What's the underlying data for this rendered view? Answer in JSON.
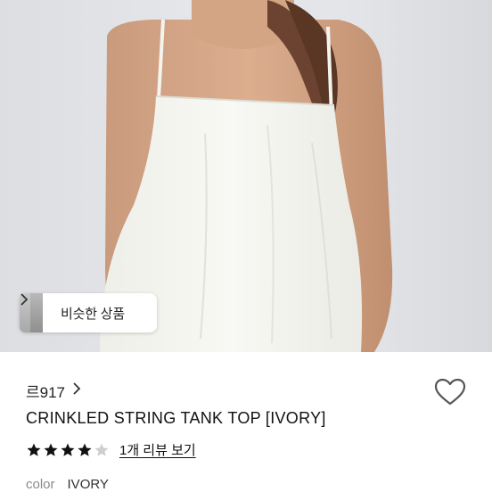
{
  "similar_products": {
    "label": "비슷한 상품",
    "icon": "chevron-right-icon"
  },
  "store": {
    "name": "르917",
    "icon": "chevron-right-icon"
  },
  "wishlist": {
    "icon": "heart-icon"
  },
  "product": {
    "title": "CRINKLED STRING TANK TOP [IVORY]",
    "rating": 4,
    "rating_max": 5,
    "review_link": "1개 리뷰 보기",
    "option_label": "color",
    "option_value": "IVORY"
  },
  "colors": {
    "star_filled": "#111111",
    "star_empty": "#cfcfcf",
    "heart_stroke": "#555555"
  }
}
